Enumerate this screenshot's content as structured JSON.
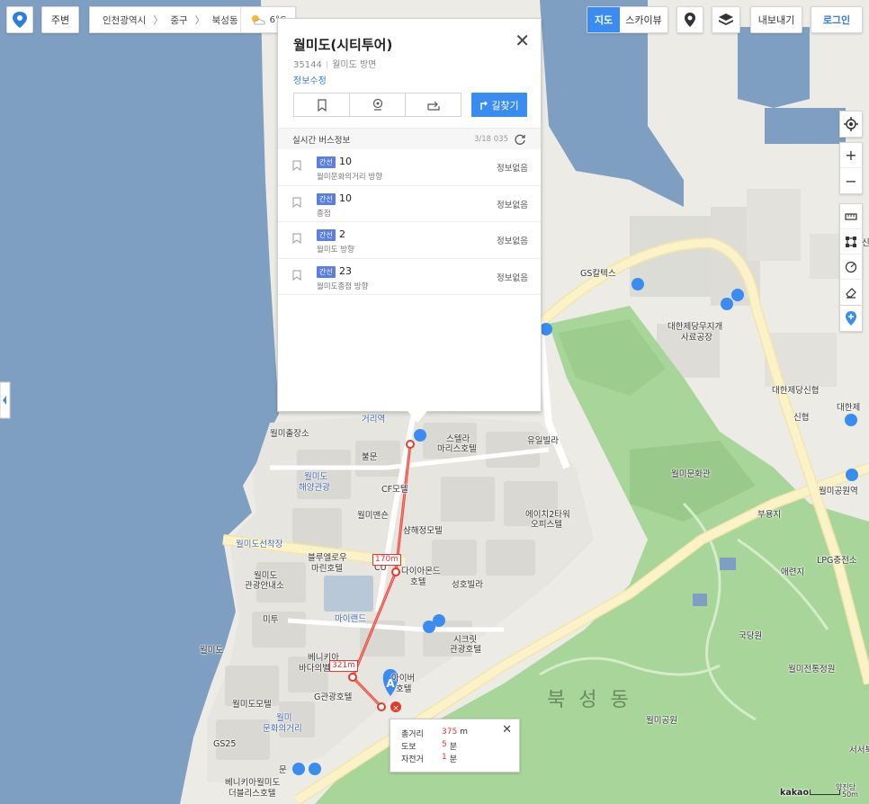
{
  "top_left": {
    "home_label": "주변"
  },
  "breadcrumb": {
    "items": [
      "인천광역시",
      "중구",
      "북성동"
    ],
    "temperature": "6°C"
  },
  "top_right": {
    "map_label": "지도",
    "skyview_label": "스카이뷰",
    "export_label": "내보내기",
    "login_label": "로그인"
  },
  "right_toolbar": {
    "zoom_in": "+",
    "zoom_out": "−"
  },
  "panel": {
    "title": "월미도(시티투어)",
    "postal": "35144",
    "direction": "월미도 방면",
    "edit_label": "정보수정",
    "route_label": "길찾기",
    "bus_header": "실시간 버스정보",
    "bus_time": "3/18 035",
    "buses": [
      {
        "type": "간선",
        "number": "10",
        "direction": "월미문화의거리 방향",
        "status": "정보없음"
      },
      {
        "type": "간선",
        "number": "10",
        "direction": "종점",
        "status": "정보없음"
      },
      {
        "type": "간선",
        "number": "2",
        "direction": "월미도 방향",
        "status": "정보없음"
      },
      {
        "type": "간선",
        "number": "23",
        "direction": "월미도종점 방향",
        "status": "정보없음"
      }
    ]
  },
  "distance": {
    "total_label": "총거리",
    "total_value": "375",
    "total_unit": "m",
    "walk_label": "도보",
    "walk_value": "5",
    "walk_unit": "분",
    "bike_label": "자전거",
    "bike_value": "1",
    "bike_unit": "분"
  },
  "segment_labels": {
    "seg1": "170m",
    "seg2": "321m"
  },
  "map_labels": {
    "gs_caltex": "GS칼텍스",
    "daehan1": "대한제당무지개",
    "daehan1b": "사료공장",
    "daehan_shin": "대한제당신협",
    "shinhyup": "신협",
    "daehan2": "대한제",
    "wolmi_chul": "월미출장소",
    "georiyeok": "거리역",
    "stella": "스텔라",
    "stella2": "마리스호텔",
    "yuil": "유일빌라",
    "wolmi_culture": "월미문화관",
    "wolmi_park_station": "월미공원역",
    "bulmun": "불문",
    "haeyang1": "월미도",
    "haeyang2": "해양관광",
    "cf": "CF모텔",
    "wolmi_mansion": "월미맨숀",
    "ah2": "에이치2타워",
    "ah2b": "오피스텔",
    "buyongji": "부용지",
    "shamhae": "샴해정모텔",
    "wharf": "월미도선착장",
    "blue1": "블루엘로우",
    "blue2": "마린호텔",
    "cu": "CU",
    "diamond": "다이아몬드",
    "diamond2": "호텔",
    "seongho": "성호빌라",
    "lpg": "LPG충전소",
    "aerinheon": "애련지",
    "wolmi_info1": "월미도",
    "wolmi_info2": "관광안내소",
    "mituh": "미투",
    "myland": "마이랜드",
    "secret1": "시크릿",
    "secret2": "관광호텔",
    "gukdanwon": "국당원",
    "wolmido": "월미도",
    "venice1": "베니키아",
    "venice2": "바다의별",
    "aibeo": "아이버",
    "aibeo2": "호텔",
    "wolmi_garden": "월미전통정원",
    "wolmi_motel": "월미도모텔",
    "g_hotel": "G관광호텔",
    "bukseong": "북 성 동",
    "wolmi1": "월미",
    "wolmi2": "문화의거리",
    "wolmi_park": "월미공원",
    "gs25": "GS25",
    "venice3": "베니키아월미도",
    "venice4": "더블리스호텔",
    "mun": "문",
    "seoseo": "서서북",
    "kakao": "kakao",
    "scale": "50m",
    "yangjin": "양진당",
    "tbl": "신"
  }
}
